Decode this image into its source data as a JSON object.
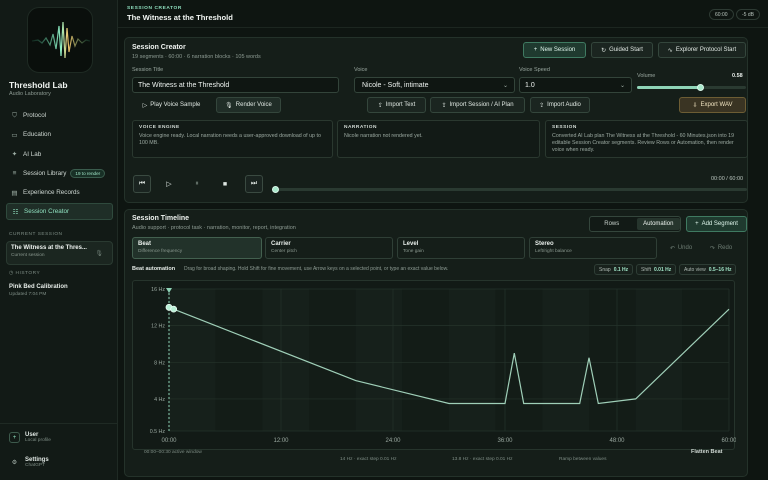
{
  "sidebar": {
    "app_name": "Threshold Lab",
    "app_sub": "Audio Laboratory",
    "nav": [
      {
        "icon": "shield-icon",
        "glyph": "⛉",
        "label": "Protocol"
      },
      {
        "icon": "book-icon",
        "glyph": "▭",
        "label": "Education"
      },
      {
        "icon": "sparkle-icon",
        "glyph": "✦",
        "label": "AI Lab"
      },
      {
        "icon": "library-icon",
        "glyph": "≡",
        "label": "Session Library",
        "badge": "19 to render"
      },
      {
        "icon": "records-icon",
        "glyph": "▤",
        "label": "Experience Records"
      },
      {
        "icon": "sliders-icon",
        "glyph": "☷",
        "label": "Session Creator",
        "active": true
      }
    ],
    "current_session_label": "CURRENT SESSION",
    "current_session": {
      "title": "The Witness at the Thres...",
      "sub": "Current session"
    },
    "history_label": "HISTORY",
    "history": [
      {
        "title": "Pink Bed Calibration",
        "sub": "Updated 7:04 PM"
      }
    ],
    "user": {
      "title": "User",
      "sub": "Local profile"
    },
    "settings": {
      "title": "Settings",
      "sub": "ChatGPT"
    }
  },
  "header": {
    "kicker": "SESSION CREATOR",
    "title": "The Witness at the Threshold",
    "duration_pill": "60:00",
    "db_pill": "-5 dB"
  },
  "creator": {
    "title": "Session Creator",
    "meta": "19 segments · 60:00 · 6 narration blocks · 105 words",
    "buttons": {
      "new_session": "New Session",
      "guided_start": "Guided Start",
      "explorer_start": "Explorer Protocol Start",
      "play_voice": "Play Voice Sample",
      "render_voice": "Render Voice",
      "import_text": "Import Text",
      "import_session": "Import Session / AI Plan",
      "import_audio": "Import Audio",
      "export_wav": "Export WAV"
    },
    "session_title_label": "Session Title",
    "session_title_value": "The Witness at the Threshold",
    "voice_label": "Voice",
    "voice_value": "Nicole - Soft, intimate",
    "voice_speed_label": "Voice Speed",
    "voice_speed_value": "1.0",
    "volume_label": "Volume",
    "volume_value": "0.58",
    "volume_level": 0.58,
    "voice_engine": {
      "heading": "VOICE ENGINE",
      "body": "Voice engine ready. Local narration needs a user-approved download of up to 100 MB."
    },
    "narration": {
      "heading": "NARRATION",
      "body": "Nicole narration not rendered yet."
    },
    "session": {
      "heading": "SESSION",
      "body": "Converted AI Lab plan The Witness at the Threshold - 60 Minutes.json into 19 editable Session Creator segments. Review Rows or Automation, then render voice when ready."
    },
    "transport_time": "00:00 / 60:00",
    "playback_position": 0
  },
  "timeline": {
    "title": "Session Timeline",
    "sub": "Audio support · protocol task · narration, monitor, report, integration",
    "view_rows": "Rows",
    "view_automation": "Automation",
    "add_segment": "Add Segment",
    "undo": "Undo",
    "redo": "Redo",
    "tabs": [
      {
        "title": "Beat",
        "sub": "Difference frequency",
        "active": true
      },
      {
        "title": "Carrier",
        "sub": "Center pitch"
      },
      {
        "title": "Level",
        "sub": "Tone gain"
      },
      {
        "title": "Stereo",
        "sub": "Left/right balance"
      }
    ],
    "automation_label": "Beat automation",
    "automation_hint": "Drag for broad shaping. Hold Shift for fine movement, use Arrow keys on a selected point, or type an exact value below.",
    "snap_label": "Snap",
    "snap_value": "0.1 Hz",
    "shift_label": "Shift",
    "shift_value": "0.01 Hz",
    "autoview_label": "Auto view",
    "autoview_value": "0.5–16 Hz",
    "footer": {
      "window": "00:00–00:30 active window",
      "step1": "14 Hz · exact step 0.01 Hz",
      "step2": "13.8 Hz · exact step 0.01 Hz",
      "ramp": "Ramp between values",
      "flatten": "Flatten Beat"
    }
  },
  "chart_data": {
    "type": "line",
    "xlabel": "",
    "ylabel": "",
    "x_ticks": [
      "00:00",
      "12:00",
      "24:00",
      "36:00",
      "48:00",
      "60:00"
    ],
    "y_ticks": [
      "0.5 Hz",
      "4 Hz",
      "8 Hz",
      "12 Hz",
      "16 Hz"
    ],
    "xlim": [
      0,
      60
    ],
    "ylim": [
      0.5,
      16
    ],
    "series": [
      {
        "values": [
          [
            0,
            14
          ],
          [
            0.5,
            13.8
          ],
          [
            20,
            6
          ],
          [
            30,
            3.5
          ],
          [
            36,
            3.5
          ],
          [
            37,
            9
          ],
          [
            38,
            3.5
          ],
          [
            44,
            3.5
          ],
          [
            45,
            8.5
          ],
          [
            46,
            3.5
          ],
          [
            50,
            4
          ],
          [
            60,
            13.8
          ]
        ]
      }
    ],
    "playhead_minute": 0,
    "accent": "#8fd4b7"
  }
}
